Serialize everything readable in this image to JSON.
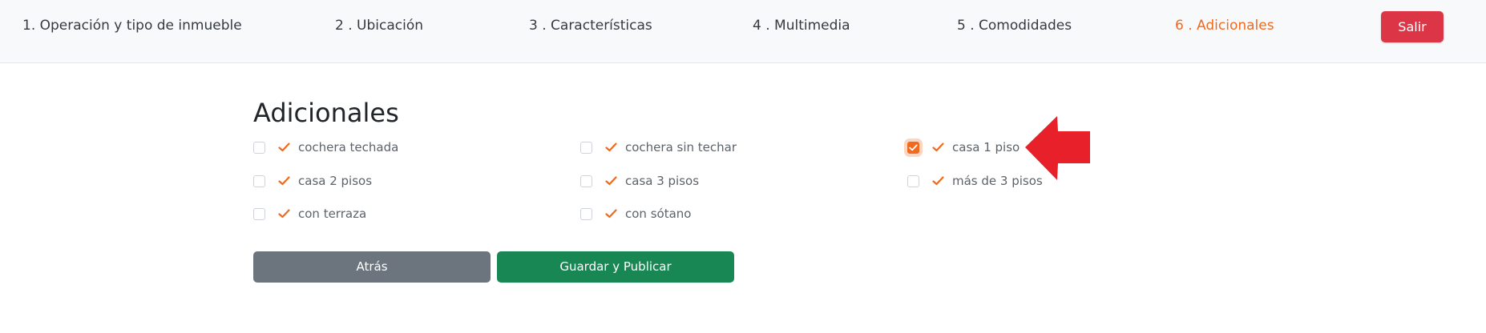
{
  "steps": [
    {
      "label": "1. Operación y tipo de inmueble"
    },
    {
      "label": "2 . Ubicación"
    },
    {
      "label": "3 . Características"
    },
    {
      "label": "4 . Multimedia"
    },
    {
      "label": "5 . Comodidades"
    },
    {
      "label": "6 . Adicionales",
      "active": true
    }
  ],
  "exit_label": "Salir",
  "section_title": "Adicionales",
  "options": [
    {
      "label": "cochera techada",
      "checked": false
    },
    {
      "label": "cochera sin techar",
      "checked": false
    },
    {
      "label": "casa 1 piso",
      "checked": true
    },
    {
      "label": "casa 2 pisos",
      "checked": false
    },
    {
      "label": "casa 3 pisos",
      "checked": false
    },
    {
      "label": "más de 3 pisos",
      "checked": false
    },
    {
      "label": "con terraza",
      "checked": false
    },
    {
      "label": "con sótano",
      "checked": false
    }
  ],
  "buttons": {
    "back_label": "Atrás",
    "save_label": "Guardar y Publicar"
  },
  "colors": {
    "accent": "#f06a20",
    "exit": "#dc3545",
    "back": "#6c757d",
    "save": "#198754",
    "annotation_arrow": "#e8202a"
  },
  "icons": {
    "option_tick": "check-icon",
    "checkbox_mark": "checkmark-icon",
    "annotation": "left-arrow-icon"
  }
}
